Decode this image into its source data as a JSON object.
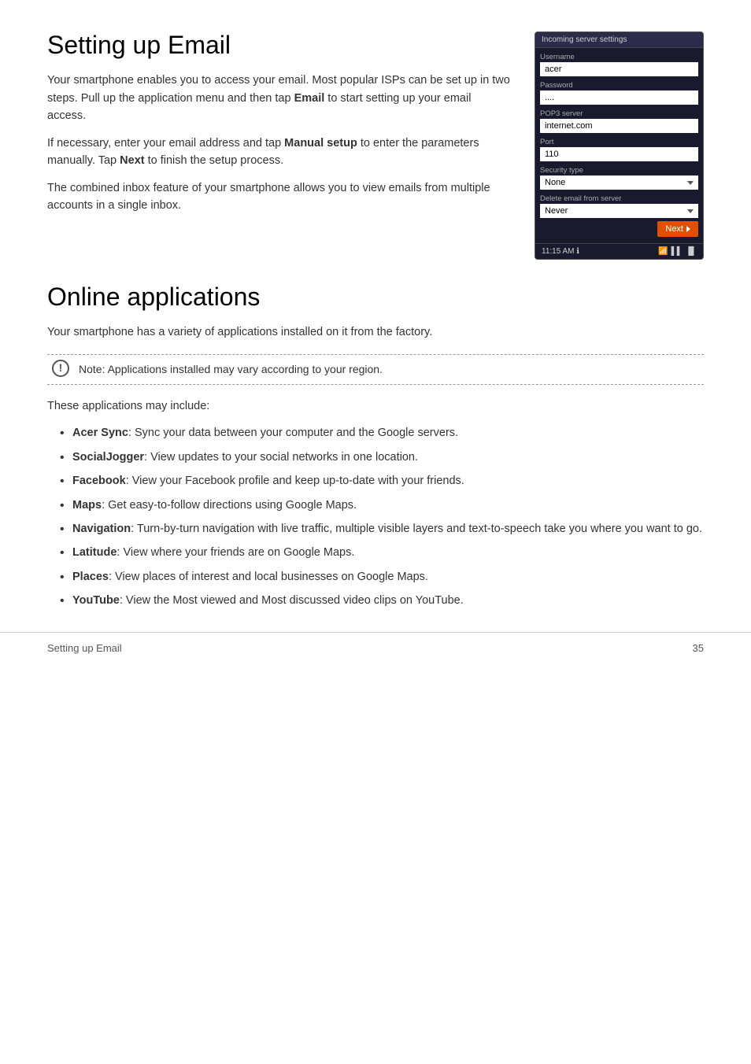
{
  "page": {
    "title": "Setting up Email",
    "footer_title": "Setting up Email",
    "page_number": "35"
  },
  "setting_up_email": {
    "title": "Setting up Email",
    "paragraph1": "Your smartphone enables you to access your email. Most popular ISPs can be set up in two steps. Pull up the application menu and then tap ",
    "paragraph1_bold": "Email",
    "paragraph1_end": " to start setting up your email access.",
    "paragraph2_start": "If necessary, enter your email address and tap ",
    "paragraph2_bold1": "Manual setup",
    "paragraph2_mid": " to enter the parameters manually. Tap ",
    "paragraph2_bold2": "Next",
    "paragraph2_end": " to finish the setup process.",
    "paragraph3": "The combined inbox feature of your smartphone allows you to view emails from multiple accounts in a single inbox."
  },
  "phone": {
    "screen_title": "Incoming server settings",
    "username_label": "Username",
    "username_value": "acer",
    "password_label": "Password",
    "password_value": "....",
    "pop3_label": "POP3 server",
    "pop3_value": "internet.com",
    "port_label": "Port",
    "port_value": "110",
    "security_label": "Security type",
    "security_value": "None",
    "delete_label": "Delete email from server",
    "delete_value": "Never",
    "next_button": "Next",
    "status_time": "11:15 AM",
    "status_info": "ℹ"
  },
  "online_applications": {
    "title": "Online applications",
    "intro": "Your smartphone has a variety of applications installed on it from the factory.",
    "note_label": "Note",
    "note_text": "Note: Applications installed may vary according to your region.",
    "these_apps": "These applications may include:",
    "apps": [
      {
        "name": "Acer Sync",
        "desc": ": Sync your data between your computer and the Google servers."
      },
      {
        "name": "SocialJogger",
        "desc": ": View updates to your social networks in one location."
      },
      {
        "name": "Facebook",
        "desc": ": View your Facebook profile and keep up-to-date with your friends."
      },
      {
        "name": "Maps",
        "desc": ": Get easy-to-follow directions using Google Maps."
      },
      {
        "name": "Navigation",
        "desc": ": Turn-by-turn navigation with live traffic, multiple visible layers and text-to-speech take you where you want to go."
      },
      {
        "name": "Latitude",
        "desc": ": View where your friends are on Google Maps."
      },
      {
        "name": "Places",
        "desc": ": View places of interest and local businesses on Google Maps."
      },
      {
        "name": "YouTube",
        "desc": ": View the Most viewed and Most discussed video clips on YouTube."
      }
    ]
  }
}
